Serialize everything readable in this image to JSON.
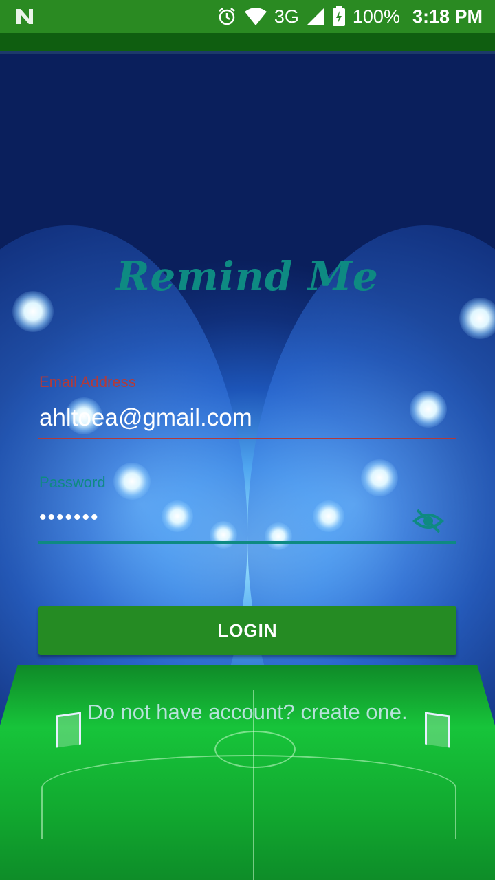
{
  "status_bar": {
    "network_label": "3G",
    "battery_percent": "100%",
    "time": "3:18 PM",
    "icons": [
      "notification-n-icon",
      "alarm-icon",
      "wifi-icon",
      "cell-signal-icon",
      "battery-charging-icon"
    ]
  },
  "app": {
    "title": "Remind Me"
  },
  "form": {
    "email_label": "Email Address",
    "email_value": "ahltoea@gmail.com",
    "password_label": "Password",
    "password_value": "•••••••",
    "visibility_icon": "visibility-off-icon"
  },
  "actions": {
    "login_label": "LOGIN",
    "signup_link": "Do not have account? create one."
  },
  "colors": {
    "status_bar": "#2a8a22",
    "title": "#0e8a82",
    "email_accent": "#b23a3a",
    "password_accent": "#0e8a82",
    "login_button": "#258b23"
  }
}
